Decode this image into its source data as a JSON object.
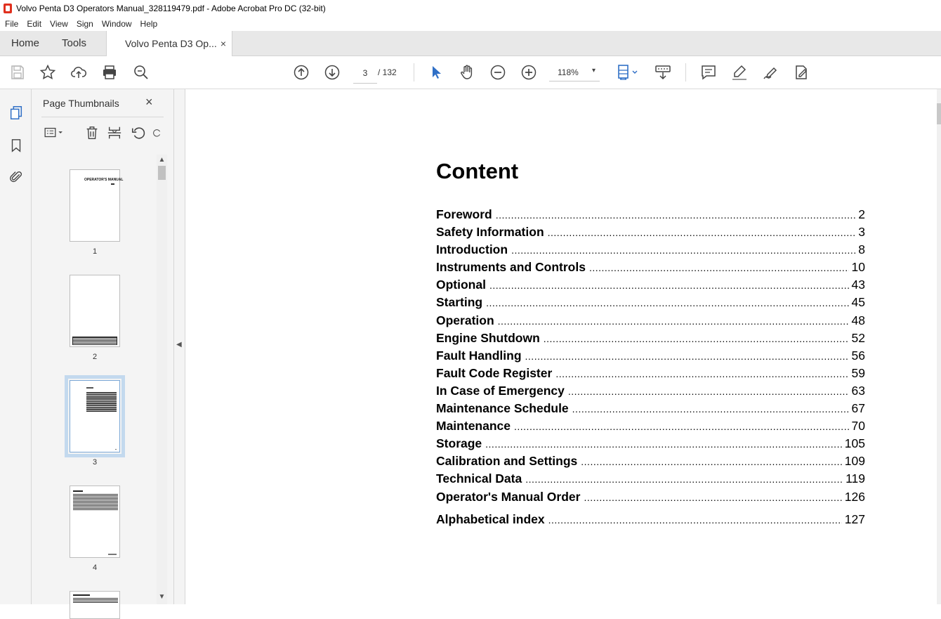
{
  "window": {
    "title": "Volvo Penta D3 Operators Manual_328119479.pdf - Adobe Acrobat Pro DC (32-bit)"
  },
  "menu": [
    "File",
    "Edit",
    "View",
    "Sign",
    "Window",
    "Help"
  ],
  "tabs": {
    "home": "Home",
    "tools": "Tools",
    "document": "Volvo Penta D3 Op...",
    "close": "×"
  },
  "toolbar": {
    "page_current": "3",
    "page_total": "/ 132",
    "zoom": "118%",
    "zoom_caret": "▾",
    "accent_color": "#2f6fc6"
  },
  "thumbnail_panel": {
    "title": "Page Thumbnails",
    "close": "×",
    "pages": [
      {
        "label": "1",
        "heading": "OPERATOR'S MANUAL"
      },
      {
        "label": "2"
      },
      {
        "label": "3",
        "selected": true
      },
      {
        "label": "4"
      }
    ]
  },
  "document": {
    "heading": "Content",
    "toc": [
      {
        "label": "Foreword",
        "page": "2"
      },
      {
        "label": "Safety Information",
        "page": "3"
      },
      {
        "label": "Introduction",
        "page": "8"
      },
      {
        "label": "Instruments and Controls",
        "page": "10"
      },
      {
        "label": "Optional",
        "page": "43"
      },
      {
        "label": "Starting",
        "page": "45"
      },
      {
        "label": "Operation",
        "page": "48"
      },
      {
        "label": "Engine Shutdown",
        "page": "52"
      },
      {
        "label": "Fault Handling",
        "page": "56"
      },
      {
        "label": "Fault Code Register",
        "page": "59"
      },
      {
        "label": "In Case of Emergency",
        "page": "63"
      },
      {
        "label": "Maintenance Schedule",
        "page": "67"
      },
      {
        "label": "Maintenance",
        "page": "70"
      },
      {
        "label": "Storage",
        "page": "105"
      },
      {
        "label": "Calibration and Settings",
        "page": "109"
      },
      {
        "label": "Technical Data",
        "page": "119"
      },
      {
        "label": "Operator's Manual Order",
        "page": "126"
      },
      {
        "label": "Alphabetical index",
        "page": "127"
      }
    ]
  }
}
